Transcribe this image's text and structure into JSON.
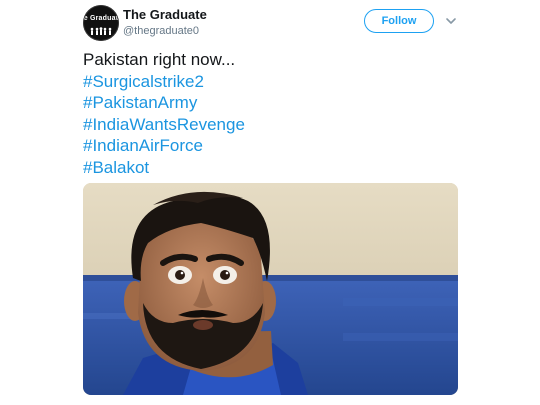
{
  "tweet": {
    "author": {
      "display_name": "The Graduate",
      "handle": "@thegraduate0",
      "avatar_text": "e Graduat"
    },
    "follow_label": "Follow",
    "caret_icon": "chevron-down-icon",
    "lines": [
      {
        "text": "Pakistan right now...",
        "type": "text"
      },
      {
        "text": "#Surgicalstrike2",
        "type": "hashtag"
      },
      {
        "text": "#PakistanArmy",
        "type": "hashtag"
      },
      {
        "text": "#IndiaWantsRevenge",
        "type": "hashtag"
      },
      {
        "text": "#IndianAirForce",
        "type": "hashtag"
      },
      {
        "text": "#Balakot",
        "type": "hashtag"
      }
    ],
    "media": {
      "kind": "photo"
    }
  },
  "colors": {
    "accent": "#1da1f2",
    "hashtag": "#1b95e0",
    "text": "#14171a",
    "muted": "#657786"
  }
}
